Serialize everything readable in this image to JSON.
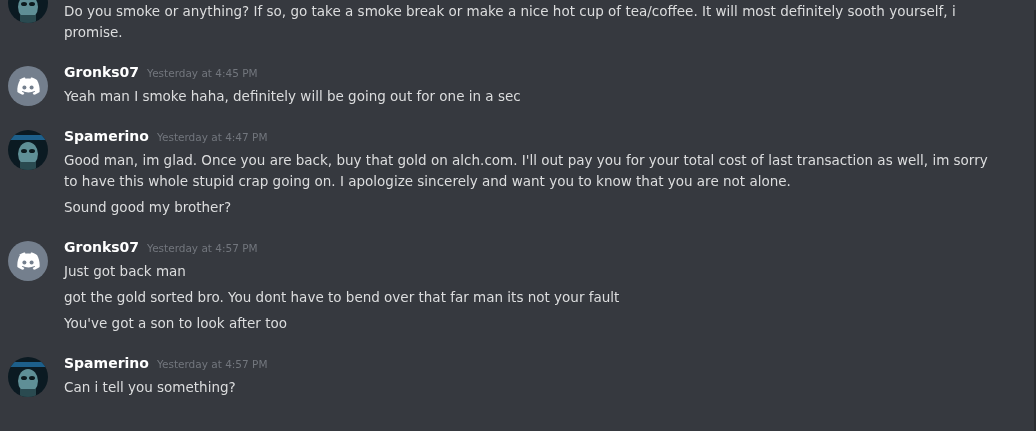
{
  "groups": [
    {
      "avatar": {
        "kind": "picture"
      },
      "messages": [
        "Do you smoke or anything? If so, go take a smoke break or make a nice hot cup of tea/coffee. It will most definitely sooth yourself, i promise."
      ]
    },
    {
      "author": "Gronks07",
      "time": "Yesterday at 4:45 PM",
      "avatar": {
        "kind": "discord"
      },
      "messages": [
        "Yeah man I smoke haha, definitely will be going out for one in a sec"
      ]
    },
    {
      "author": "Spamerino",
      "time": "Yesterday at 4:47 PM",
      "avatar": {
        "kind": "picture"
      },
      "messages": [
        "Good man, im glad. Once you are back, buy that gold on alch.com. I'll out pay you for your total cost of last transaction as well, im sorry to have this whole stupid crap going on. I apologize sincerely and want you to know that you are not alone.",
        "Sound good my brother?"
      ]
    },
    {
      "author": "Gronks07",
      "time": "Yesterday at 4:57 PM",
      "avatar": {
        "kind": "discord"
      },
      "messages": [
        "Just got back man",
        "got the gold sorted bro. You dont have to bend over that far man its not your fault",
        "You've got a son to look after too"
      ]
    },
    {
      "author": "Spamerino",
      "time": "Yesterday at 4:57 PM",
      "avatar": {
        "kind": "picture"
      },
      "messages": [
        "Can i tell you something?"
      ]
    }
  ]
}
